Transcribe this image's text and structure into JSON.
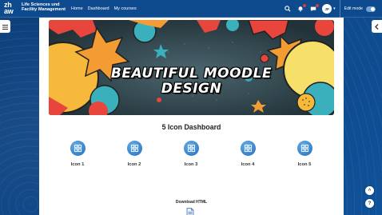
{
  "brand": {
    "logo_text": "zh aw",
    "institute": "Life Sciences und Facility Management"
  },
  "nav": {
    "links": [
      "Home",
      "Dashboard",
      "My courses"
    ]
  },
  "user": {
    "initials": "JP",
    "edit_mode_label": "Edit mode"
  },
  "banner": {
    "title_line1": "BEAUTIFUL MOODLE",
    "title_line2": "DESIGN"
  },
  "dashboard": {
    "title": "5 Icon Dashboard",
    "icons": [
      {
        "label": "Icon 1"
      },
      {
        "label": "Icon 2"
      },
      {
        "label": "Icon 3"
      },
      {
        "label": "Icon 4"
      },
      {
        "label": "Icon 5"
      }
    ]
  },
  "download": {
    "label": "Download HTML"
  },
  "floating": {
    "scroll_top": "^",
    "help": "?"
  },
  "colors": {
    "navbar": "#0d4a8e",
    "accent": "#3b87cf",
    "page_bg": "#ffffff"
  }
}
